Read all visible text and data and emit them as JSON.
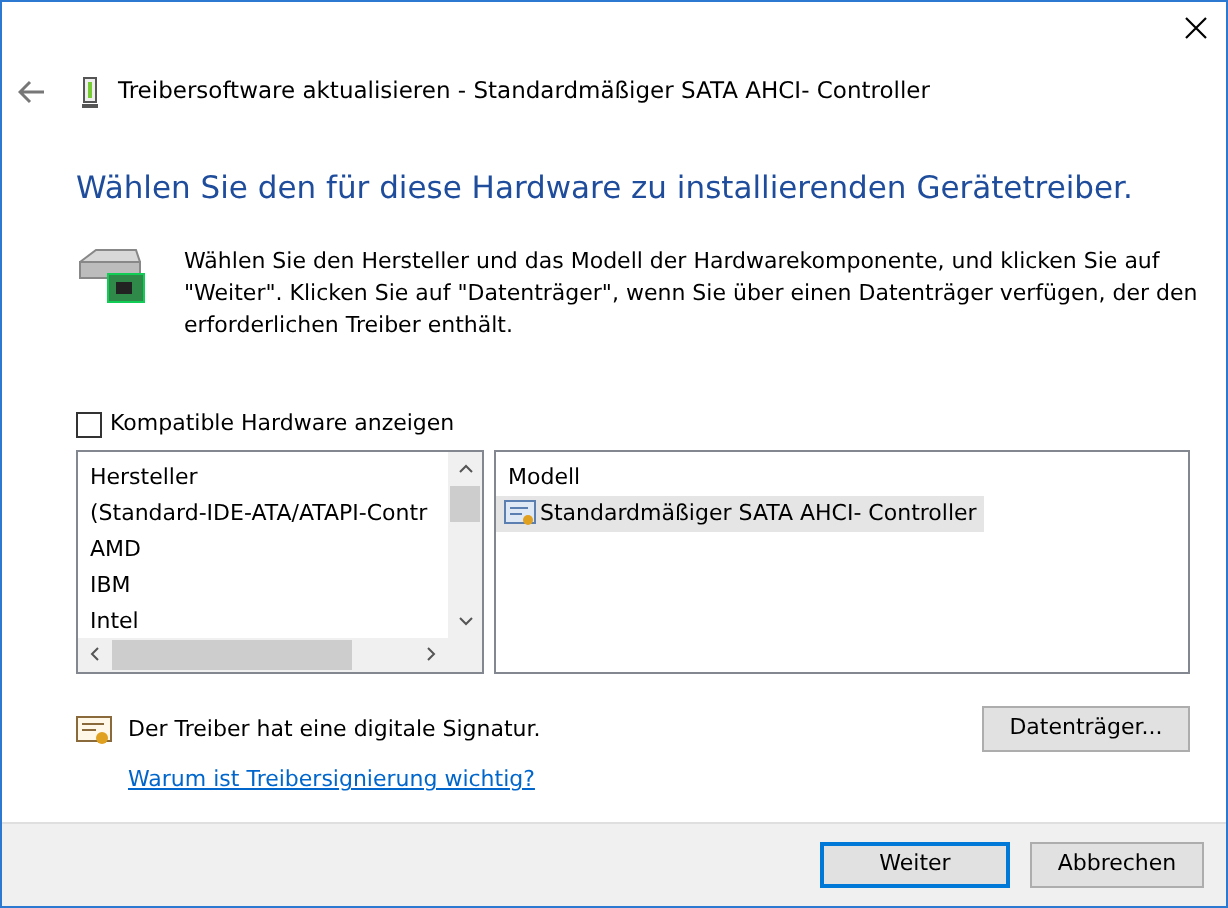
{
  "window": {
    "title": "Treibersoftware aktualisieren - Standardmäßiger SATA AHCI- Controller"
  },
  "heading": "Wählen Sie den für diese Hardware zu installierenden Gerätetreiber.",
  "description": "Wählen Sie den Hersteller und das Modell der Hardwarekomponente, und klicken Sie auf \"Weiter\". Klicken Sie auf \"Datenträger\", wenn Sie über einen Datenträger verfügen, der den erforderlichen Treiber enthält.",
  "compatible_checkbox": {
    "label": "Kompatible Hardware anzeigen",
    "checked": false
  },
  "manufacturers": {
    "header": "Hersteller",
    "items": [
      {
        "label": "(Standard-IDE-ATA/ATAPI-Contr",
        "selected": false
      },
      {
        "label": "AMD",
        "selected": false
      },
      {
        "label": "IBM",
        "selected": false
      },
      {
        "label": "Intel",
        "selected": false
      }
    ]
  },
  "models": {
    "header": "Modell",
    "items": [
      {
        "label": "Standardmäßiger SATA AHCI- Controller",
        "selected": true
      }
    ]
  },
  "signature": "Der Treiber hat eine digitale Signatur.",
  "signature_link": "Warum ist Treibersignierung wichtig?",
  "disk_button": "Datenträger...",
  "buttons": [
    {
      "label": "Weiter",
      "default": true
    },
    {
      "label": "Abbrechen",
      "default": false
    }
  ]
}
